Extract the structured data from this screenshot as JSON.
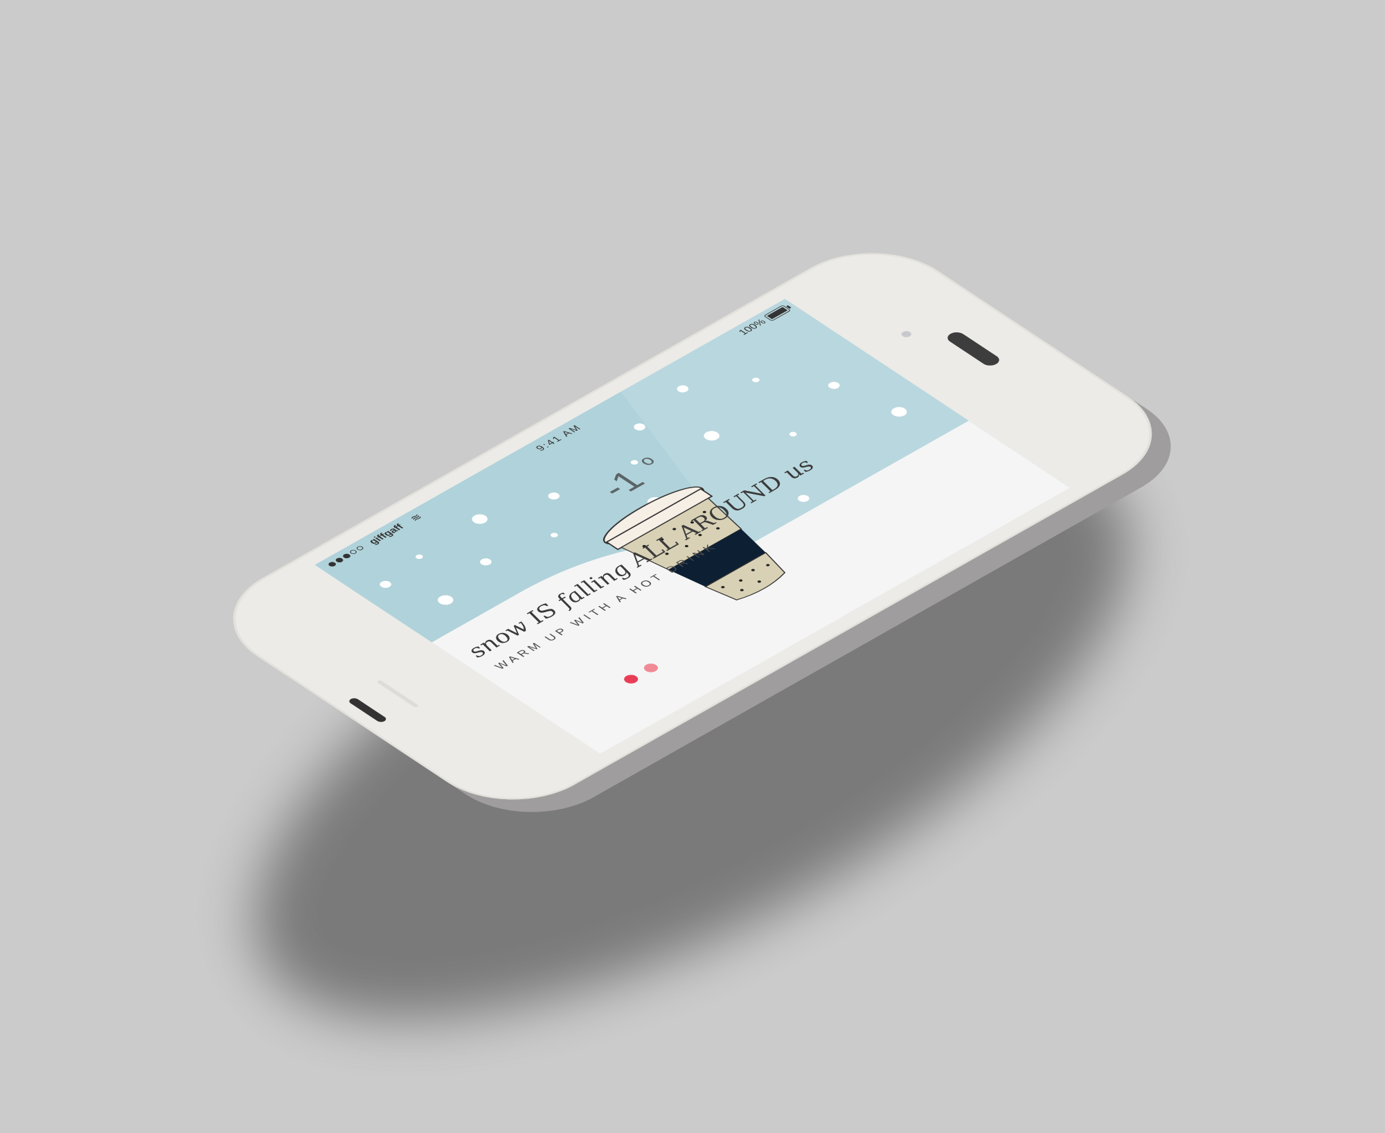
{
  "status_bar": {
    "carrier": "giffgaff",
    "time": "9:41 AM",
    "battery": "100%",
    "signal_bars_filled": 3,
    "signal_bars_total": 5
  },
  "weather": {
    "temperature": "-1",
    "degree_symbol": "o"
  },
  "message": {
    "headline": "snow IS falling ALL AROUND us",
    "subline": "WARM UP WITH A HOT DRINK"
  },
  "pager": {
    "pages": 2,
    "current": 1
  },
  "colors": {
    "sky": "#b0d2da",
    "snow": "#f5f5f5",
    "accent": "#e83e55",
    "cup_sleeve": "#0d1f33",
    "cup_body": "#d8d1b5"
  },
  "icons": [
    "wifi-icon",
    "battery-icon",
    "coffee-cup-icon"
  ]
}
